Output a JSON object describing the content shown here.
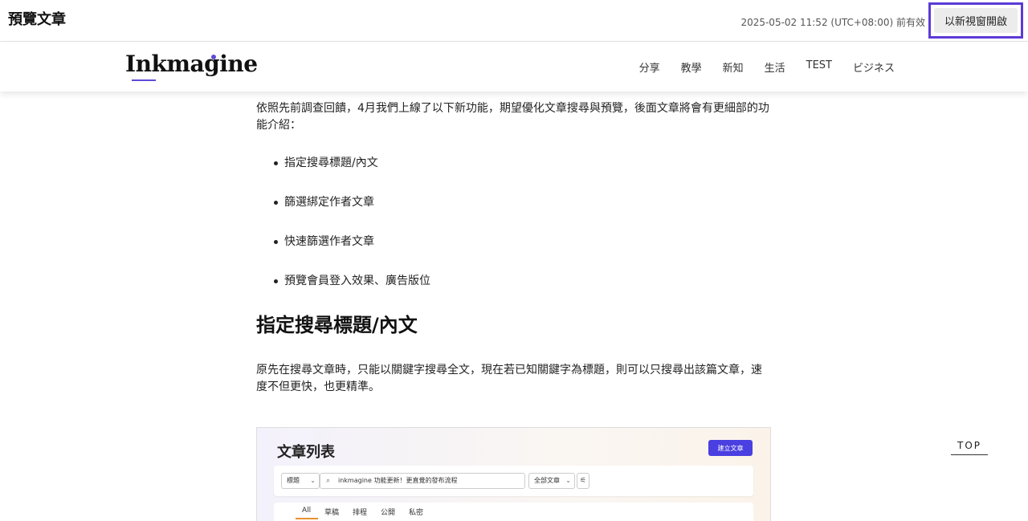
{
  "preview": {
    "title": "預覽文章",
    "valid_until": "2025-05-02 11:52 (UTC+08:00) 前有效",
    "open_new_window_label": "以新視窗開啟"
  },
  "site": {
    "logo_text": "Inkmagine",
    "nav": [
      "分享",
      "教學",
      "新知",
      "生活",
      "TEST",
      "ビジネス"
    ]
  },
  "article": {
    "intro": "依照先前調查回饋，4月我們上線了以下新功能，期望優化文章搜尋與預覽，後面文章將會有更細部的功能介紹：",
    "bullets": [
      "指定搜尋標題/內文",
      "篩選綁定作者文章",
      "快速篩選作者文章",
      "預覽會員登入效果、廣告版位"
    ],
    "heading": "指定搜尋標題/內文",
    "body": "原先在搜尋文章時，只能以關鍵字搜尋全文，現在若已知關鍵字為標題，則可以只搜尋出該篇文章，速度不但更快，也更精準。"
  },
  "figure": {
    "title": "文章列表",
    "create_button": "建立文章",
    "search_field_select": "標題",
    "search_value": "inkmagine 功能更新！更直覺的發布流程",
    "category_select": "全部文章",
    "tabs": [
      "All",
      "草稿",
      "排程",
      "公開",
      "私密"
    ]
  },
  "top_button": "TOP",
  "colors": {
    "accent": "#5b3bd6",
    "create_button": "#4a3fe0",
    "tab_underline": "#e8922f"
  }
}
